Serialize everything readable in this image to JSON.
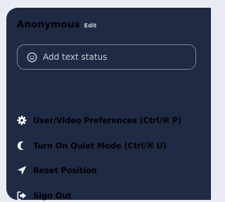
{
  "user": {
    "name": "Anonymous",
    "edit_label": "Edit"
  },
  "status": {
    "placeholder": "Add text status",
    "icon": "smiley-icon"
  },
  "menu": {
    "items": [
      {
        "label": "User/Video Preferences (Ctrl/⌘ P)",
        "icon": "gear-icon"
      },
      {
        "label": "Turn On Quiet Mode (Ctrl/⌘ U)",
        "icon": "moon-icon"
      },
      {
        "label": "Reset Position",
        "icon": "location-arrow-icon"
      },
      {
        "label": "Sign Out",
        "icon": "sign-out-icon"
      }
    ]
  },
  "colors": {
    "panel_background": "#1f2a44",
    "page_background": "#e9ecf2",
    "text": "#ffffff",
    "muted_text": "#c8cdd8",
    "field_border": "#7f889c"
  }
}
